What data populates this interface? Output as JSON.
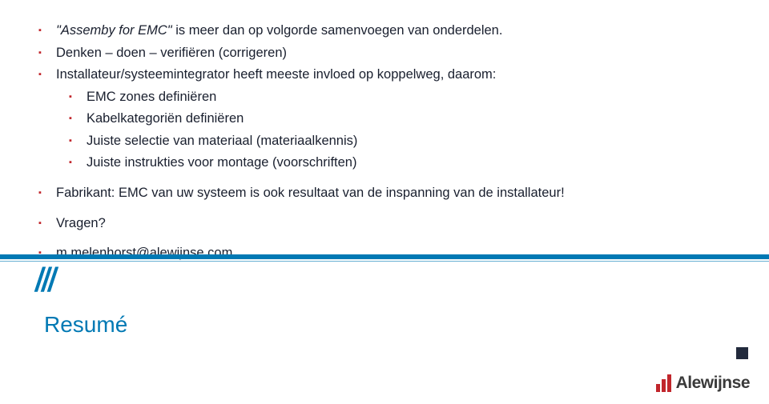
{
  "bullets": {
    "b1_prefix": "\"Assemby for EMC\"",
    "b1_rest": " is meer dan op volgorde samenvoegen van onderdelen.",
    "b2": "Denken – doen – verifiëren (corrigeren)",
    "b3": "Installateur/systeemintegrator heeft meeste invloed op koppelweg, daarom:",
    "b3_children": {
      "c1": "EMC zones definiëren",
      "c2": "Kabelkategoriën definiëren",
      "c3": "Juiste selectie van materiaal (materiaalkennis)",
      "c4": "Juiste instrukties voor montage (voorschriften)"
    },
    "b4": "Fabrikant: EMC van uw systeem is ook resultaat van de inspanning van de installateur!",
    "b5": "Vragen?",
    "b6_email": "m.melenhorst@alewijnse.com"
  },
  "decorations": {
    "hashes": "///"
  },
  "footer_title": "Resumé",
  "logo": {
    "text": "Alewijnse"
  }
}
